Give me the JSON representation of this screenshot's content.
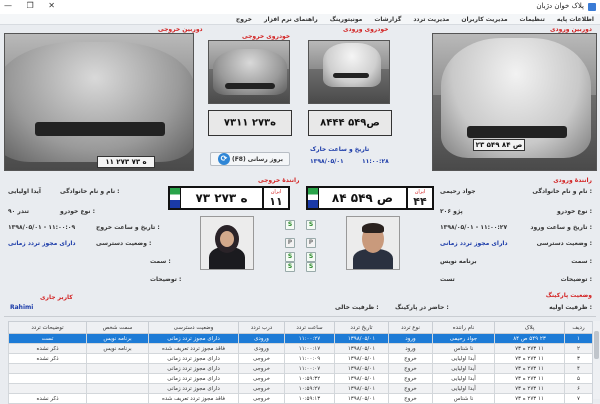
{
  "window": {
    "title": "پلاک خوان دژبان"
  },
  "menu": [
    "اطلاعات پایه",
    "تنظیمات",
    "مدیریت کاربران",
    "مدیریت تردد",
    "گزارشات",
    "مونیتورینگ",
    "راهنمای نرم افزار",
    "خروج"
  ],
  "cameras": {
    "entry_label": "دوربین ورودی",
    "exit_label": "دوربین خروجی",
    "entry_car_label": "خودروی ورودی",
    "exit_car_label": "خودروی خروجی",
    "entry_plate_text": "۲۳ ۵۴۹ ص ۸۴",
    "exit_plate_text": "۱۱ ۲۷۳ ه ۷۳",
    "entry_read": "۸۴ص۵۴۹ ۴۴",
    "exit_read": "۷۳ه۲۷۳ ۱۱"
  },
  "refresh_button": "بروز رسانی (F8)",
  "exit_datetime": {
    "label": "تاریخ و ساعت خارک",
    "date": "۱۳۹۸/۰۵/۰۱",
    "time": "۱۱:۰۰:۲۸"
  },
  "entry_plate": {
    "label": "رانندهٔ ورودی",
    "iran": "ایران",
    "code": "۴۴",
    "main": "۸۴ ص ۵۴۹"
  },
  "exit_plate": {
    "label": "رانندهٔ خروجی",
    "iran": "ایران",
    "code": "۱۱",
    "main": "۷۳ ه ۲۷۳"
  },
  "entry_info": {
    "name_label": "نام و نام خانوادگی :",
    "name": "جواد رحیمی",
    "vehicle_label": "نوع خودرو :",
    "vehicle": "پژو ۲۰۶",
    "datetime_label": "تاریخ و ساعت ورود :",
    "datetime": "۱۳۹۸/۰۵/۰۱ - ۱۱:۰۰:۲۷",
    "access_label": "وضعیت دسترسی :",
    "access": "دارای مجوز تردد زمانی",
    "post_label": "سمت :",
    "post": "برنامه نویس",
    "desc_label": "توضیحات :",
    "desc": "تست",
    "parking_label": "وضعیت پارکینگ",
    "capacity_label": "ظرفیت اولیه :",
    "present_label": "حاضر در پارکینگ :"
  },
  "exit_info": {
    "name_label": "نام و نام خانوادگی :",
    "name": "آیدا اولیایی",
    "vehicle_label": "نوع خودرو :",
    "vehicle": "تندر ۹۰",
    "datetime_label": "تاریخ و ساعت خروج :",
    "datetime": "۱۳۹۸/۰۵/۰۱ - ۱۱:۰۰:۰۹",
    "access_label": "وضعیت دسترسی :",
    "access": "دارای مجوز تردد زمانی",
    "post_label": "سمت :",
    "post": "",
    "desc_label": "توضیحات :",
    "desc": "",
    "capacity_label": "ظرفیت خالی :",
    "operator_label": "کاربر جاری",
    "operator": "Rahimi"
  },
  "checks": [
    "S",
    "S",
    "P",
    "P",
    "S",
    "S",
    "S",
    "S"
  ],
  "table": {
    "headers": [
      "ردیف",
      "پلاک",
      "نام راننده",
      "نوع تردد",
      "تاریخ تردد",
      "ساعت تردد",
      "درب تردد",
      "وضعیت دسترسی",
      "سمت شخص",
      "توضیحات تردد"
    ],
    "rows": [
      [
        "۱",
        "۲۳ ۵۴۹ ص ۸۴",
        "جواد رحیمی",
        "ورود",
        "۱۳۹۸/۰۵/۰۱",
        "۱۱:۰۰:۲۷",
        "ورودی",
        "دارای مجوز تردد زمانی",
        "برنامه نویس",
        "تست"
      ],
      [
        "۲",
        "۱۱ ۲۷۳ ه ۷۳",
        "نا شناس",
        "ورود",
        "۱۳۹۸/۰۵/۰۱",
        "۱۱:۰۰:۱۷",
        "ورودی",
        "فاقد مجوز تردد تعریف شده",
        "برنامه نویس",
        "ذکر نشده"
      ],
      [
        "۳",
        "۱۱ ۲۷۳ ه ۷۳",
        "آیدا اولیایی",
        "خروج",
        "۱۳۹۸/۰۵/۰۱",
        "۱۱:۰۰:۰۹",
        "خروجی",
        "دارای مجوز تردد زمانی",
        "",
        "ذکر نشده"
      ],
      [
        "۴",
        "۱۱ ۲۷۳ ه ۷۳",
        "آیدا اولیایی",
        "خروج",
        "۱۳۹۸/۰۵/۰۱",
        "۱۱:۰۰:۰۷",
        "خروجی",
        "دارای مجوز تردد زمانی",
        "",
        ""
      ],
      [
        "۵",
        "۱۱ ۲۷۳ ه ۷۳",
        "آیدا اولیایی",
        "خروج",
        "۱۳۹۸/۰۵/۰۱",
        "۱۰:۵۹:۳۲",
        "خروجی",
        "دارای مجوز تردد زمانی",
        "",
        ""
      ],
      [
        "۶",
        "۱۱ ۲۷۳ ه ۷۳",
        "آیدا اولیایی",
        "خروج",
        "۱۳۹۸/۰۵/۰۱",
        "۱۰:۵۹:۲۷",
        "خروجی",
        "دارای مجوز تردد زمانی",
        "",
        ""
      ],
      [
        "۷",
        "۱۱ ۲۷۳ ه ۷۳",
        "نا شناس",
        "خروج",
        "۱۳۹۸/۰۵/۰۱",
        "۱۰:۵۹:۱۳",
        "خروجی",
        "فاقد مجوز تردد تعریف شده",
        "",
        "ذکر نشده"
      ]
    ]
  }
}
